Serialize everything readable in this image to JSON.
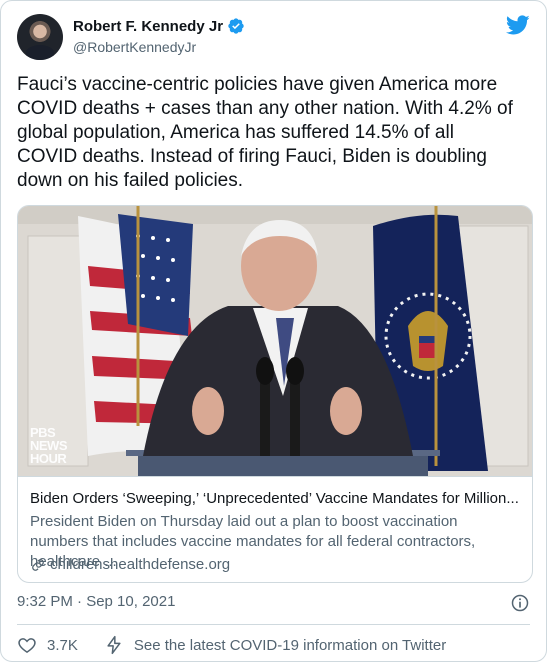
{
  "author": {
    "name": "Robert F. Kennedy Jr",
    "handle": "@RobertKennedyJr",
    "verified": true
  },
  "tweet": {
    "text": "Fauci’s vaccine-centric policies have given America more\nCOVID deaths + cases than any other nation. With 4.2% of\nglobal population, America has suffered 14.5% of all\nCOVID deaths. Instead of firing Fauci, Biden is doubling\ndown on his failed policies.",
    "timestamp": "9:32 PM · Sep 10, 2021"
  },
  "card": {
    "image_watermark_lines": [
      "PBS",
      "NEWS",
      "HOUR"
    ],
    "title": "Biden Orders ‘Sweeping,’ ‘Unprecedented’ Vaccine Mandates for Million...",
    "description": "President Biden on Thursday laid out a plan to boost vaccination numbers that includes vaccine mandates for all federal contractors, healthcare ...",
    "domain": "childrenshealthdefense.org"
  },
  "actions": {
    "like_count": "3.7K",
    "covid_info_label": "See the latest COVID-19 information on Twitter"
  },
  "icons": {
    "brand": "twitter-bird-icon",
    "verified": "verified-badge-icon",
    "info": "info-icon",
    "like": "heart-icon",
    "bolt": "bolt-icon",
    "link": "link-icon"
  },
  "colors": {
    "twitter_blue": "#1d9bf0",
    "text_primary": "#0f1419",
    "text_secondary": "#536471",
    "border": "#cfd9de"
  }
}
